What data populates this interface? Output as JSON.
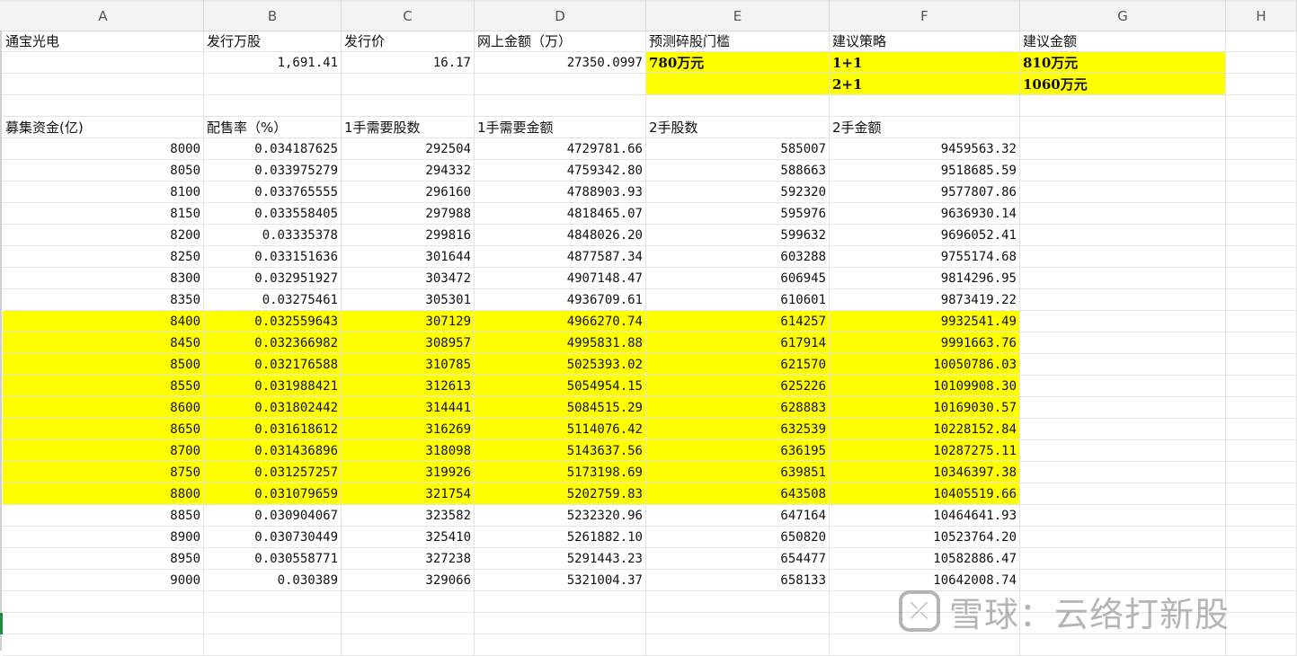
{
  "columns": [
    "A",
    "B",
    "C",
    "D",
    "E",
    "F",
    "G",
    "H"
  ],
  "header_rows": [
    {
      "A": "通宝光电",
      "B": "发行万股",
      "C": "发行价",
      "D": "网上金额（万）",
      "E": "预测碎股门槛",
      "F": "建议策略",
      "G": "建议金额",
      "H": ""
    },
    {
      "A": "",
      "B": "1,691.41",
      "C": "16.17",
      "D": "27350.0997",
      "E": "780万元",
      "F": "1+1",
      "G": "810万元",
      "H": ""
    },
    {
      "A": "",
      "B": "",
      "C": "",
      "D": "",
      "E": "",
      "F": "2+1",
      "G": "1060万元",
      "H": ""
    },
    {
      "A": "",
      "B": "",
      "C": "",
      "D": "",
      "E": "",
      "F": "",
      "G": "",
      "H": ""
    },
    {
      "A": "募集资金(亿)",
      "B": "配售率（%）",
      "C": "1手需要股数",
      "D": "1手需要金额",
      "E": "2手股数",
      "F": "2手金额",
      "G": "",
      "H": ""
    }
  ],
  "data_rows": [
    [
      "8000",
      "0.034187625",
      "292504",
      "4729781.66",
      "585007",
      "9459563.32"
    ],
    [
      "8050",
      "0.033975279",
      "294332",
      "4759342.80",
      "588663",
      "9518685.59"
    ],
    [
      "8100",
      "0.033765555",
      "296160",
      "4788903.93",
      "592320",
      "9577807.86"
    ],
    [
      "8150",
      "0.033558405",
      "297988",
      "4818465.07",
      "595976",
      "9636930.14"
    ],
    [
      "8200",
      "0.03335378",
      "299816",
      "4848026.20",
      "599632",
      "9696052.41"
    ],
    [
      "8250",
      "0.033151636",
      "301644",
      "4877587.34",
      "603288",
      "9755174.68"
    ],
    [
      "8300",
      "0.032951927",
      "303472",
      "4907148.47",
      "606945",
      "9814296.95"
    ],
    [
      "8350",
      "0.03275461",
      "305301",
      "4936709.61",
      "610601",
      "9873419.22"
    ],
    [
      "8400",
      "0.032559643",
      "307129",
      "4966270.74",
      "614257",
      "9932541.49"
    ],
    [
      "8450",
      "0.032366982",
      "308957",
      "4995831.88",
      "617914",
      "9991663.76"
    ],
    [
      "8500",
      "0.032176588",
      "310785",
      "5025393.02",
      "621570",
      "10050786.03"
    ],
    [
      "8550",
      "0.031988421",
      "312613",
      "5054954.15",
      "625226",
      "10109908.30"
    ],
    [
      "8600",
      "0.031802442",
      "314441",
      "5084515.29",
      "628883",
      "10169030.57"
    ],
    [
      "8650",
      "0.031618612",
      "316269",
      "5114076.42",
      "632539",
      "10228152.84"
    ],
    [
      "8700",
      "0.031436896",
      "318098",
      "5143637.56",
      "636195",
      "10287275.11"
    ],
    [
      "8750",
      "0.031257257",
      "319926",
      "5173198.69",
      "639851",
      "10346397.38"
    ],
    [
      "8800",
      "0.031079659",
      "321754",
      "5202759.83",
      "643508",
      "10405519.66"
    ],
    [
      "8850",
      "0.030904067",
      "323582",
      "5232320.96",
      "647164",
      "10464641.93"
    ],
    [
      "8900",
      "0.030730449",
      "325410",
      "5261882.10",
      "650820",
      "10523764.20"
    ],
    [
      "8950",
      "0.030558771",
      "327238",
      "5291443.23",
      "654477",
      "10582886.47"
    ],
    [
      "9000",
      "0.030389",
      "329066",
      "5321004.37",
      "658133",
      "10642008.74"
    ]
  ],
  "highlighted_data_range": {
    "first_value": "8400",
    "last_value": "8800"
  },
  "colors": {
    "highlight": "#ffff00",
    "header_bg": "#f3f3f3",
    "grid": "#e3e3e3"
  },
  "watermark": {
    "icon": "snowball-logo-icon",
    "text": "雪球：云络打新股"
  }
}
